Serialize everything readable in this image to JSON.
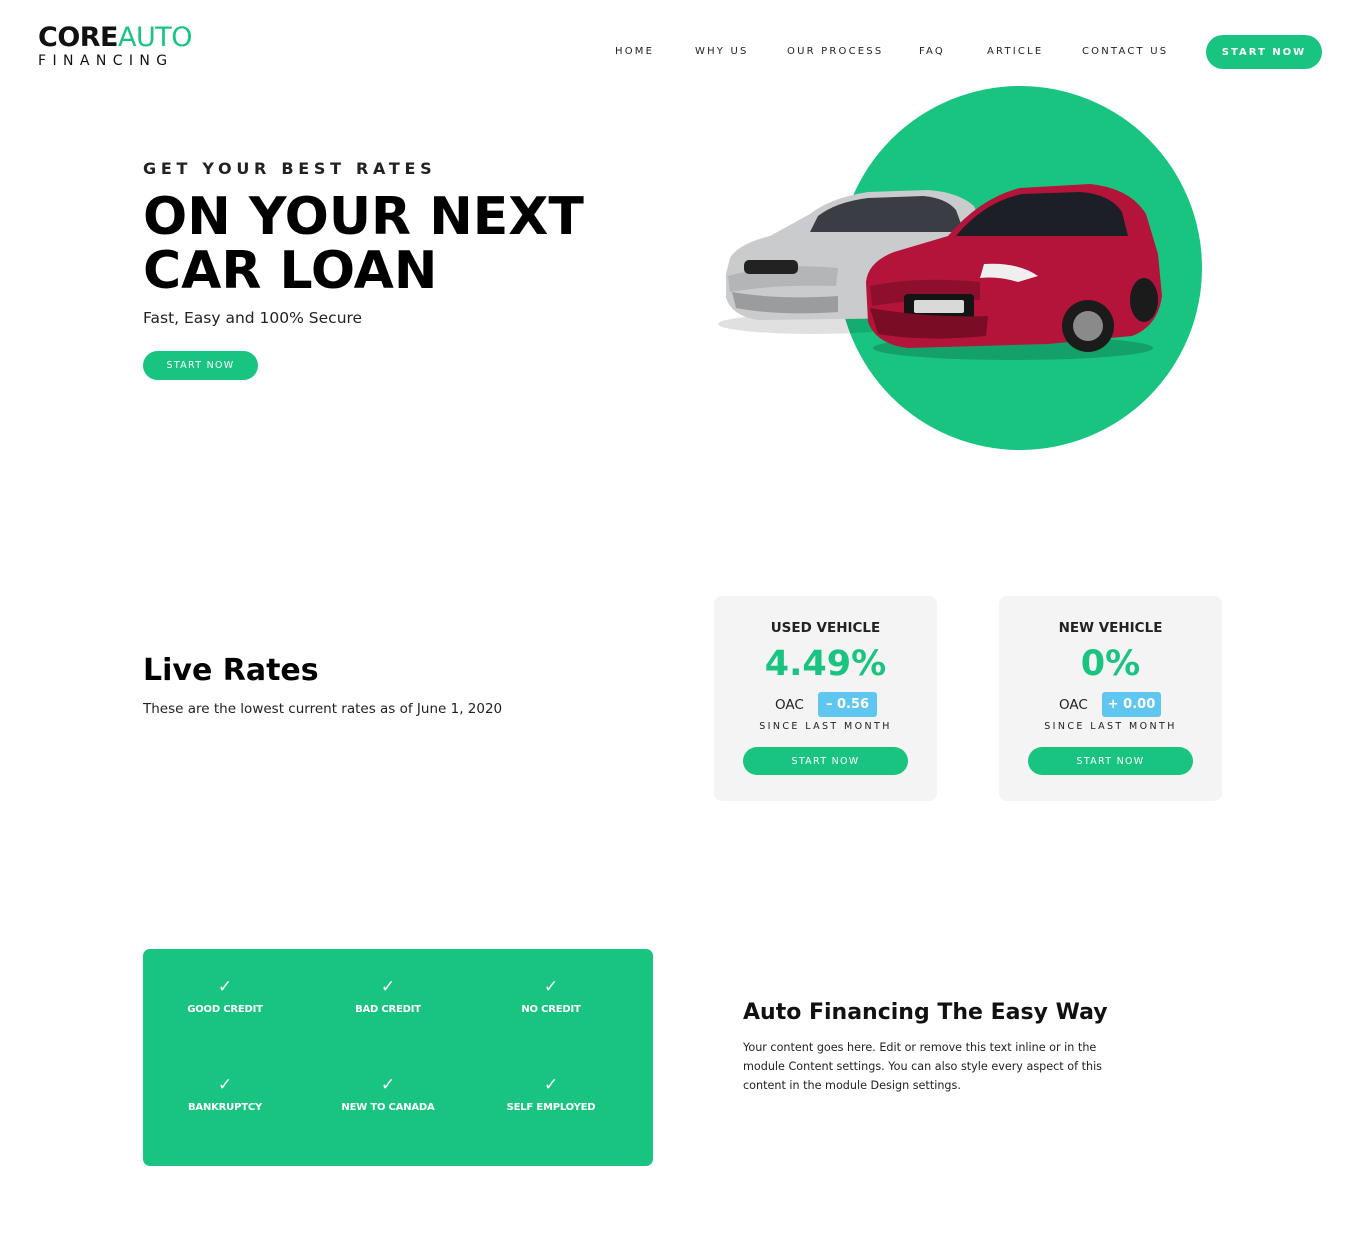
{
  "brand": {
    "name_core": "CORE",
    "name_auto": "AUTO",
    "tagline": "FINANCING",
    "accent_color": "#19c480",
    "badge_color": "#5fc7ef"
  },
  "nav": {
    "items": [
      "HOME",
      "WHY US",
      "OUR PROCESS",
      "FAQ",
      "ARTICLE",
      "CONTACT US"
    ],
    "cta": "START NOW"
  },
  "hero": {
    "kicker": "GET YOUR BEST RATES",
    "title_line1": "ON YOUR NEXT",
    "title_line2": "CAR LOAN",
    "subtitle": "Fast, Easy and 100% Secure",
    "cta": "START NOW",
    "image": "two-cars-on-green-circle"
  },
  "live_rates": {
    "title": "Live Rates",
    "description": "These are the lowest current rates as of June 1, 2020",
    "cards": [
      {
        "title": "USED VEHICLE",
        "rate": "4.49%",
        "oac": "OAC",
        "change": "– 0.56",
        "since": "SINCE LAST MONTH",
        "cta": "START NOW"
      },
      {
        "title": "NEW VEHICLE",
        "rate": "0%",
        "oac": "OAC",
        "change": "+ 0.00",
        "since": "SINCE LAST MONTH",
        "cta": "START NOW"
      }
    ]
  },
  "credit_types": {
    "check_glyph": "✓",
    "items": [
      "GOOD CREDIT",
      "BAD CREDIT",
      "NO CREDIT",
      "BANKRUPTCY",
      "NEW TO CANADA",
      "SELF EMPLOYED"
    ]
  },
  "easy_way": {
    "title": "Auto Financing The Easy Way",
    "text": "Your content goes here. Edit or remove this text inline or in the module Content settings. You can also style every aspect of this content in the module Design settings."
  }
}
